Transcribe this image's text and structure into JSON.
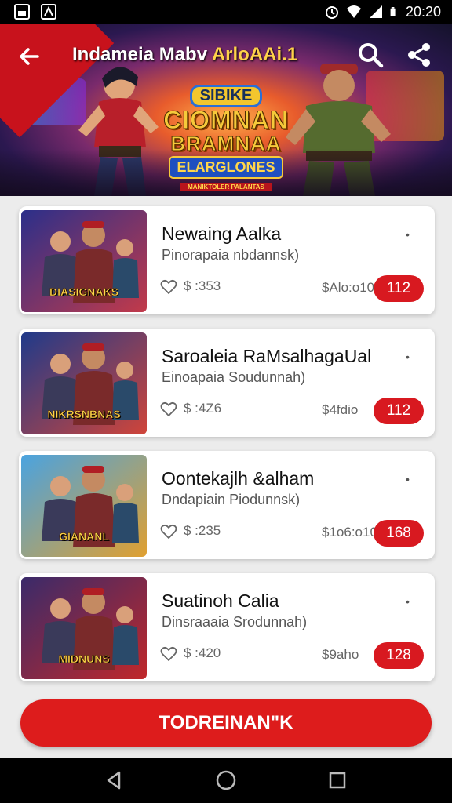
{
  "status_bar": {
    "time": "20:20",
    "icons": [
      "notification-icon",
      "app-icon",
      "alarm-icon",
      "wifi-icon",
      "signal-icon",
      "battery-icon"
    ]
  },
  "header": {
    "title_main": "Indameia Mabv ",
    "title_accent": "ArloAAi.1",
    "back_icon": "back-arrow-icon",
    "search_icon": "search-icon",
    "share_icon": "share-icon"
  },
  "banner": {
    "logo_top": "SIBIKE",
    "logo_line1": "CIOMNAN",
    "logo_line2": "BRAMNAA",
    "logo_bottom": "ELARGLONES",
    "logo_ribbon": "MANIKTOLER PALANTAS"
  },
  "items": [
    {
      "title": "Newaing Aalka",
      "subtitle": "Pinorapaia nbdannsk)",
      "price": "$ :353",
      "sales": "$Alo:o10",
      "badge": "112",
      "thumb_label": "DIASIGNAKS",
      "thumb_colors": [
        "#2b2f8a",
        "#c23a4a"
      ]
    },
    {
      "title": "Saroaleia RaMsalhagaUal",
      "subtitle": "Einoapaia Soudunnah)",
      "price": "$ :4Z6",
      "sales": "$4fdio",
      "badge": "112",
      "thumb_label": "NIKRSNBNAS",
      "thumb_colors": [
        "#1f3a8a",
        "#d0453a"
      ]
    },
    {
      "title": "Oontekajlh &alham",
      "subtitle": "Dndapiain Piodunnsk)",
      "price": "$ :235",
      "sales": "$1o6:o10",
      "badge": "168",
      "thumb_label": "GIANANL",
      "thumb_colors": [
        "#4aa3e0",
        "#e0a030"
      ]
    },
    {
      "title": "Suatinoh Calia",
      "subtitle": "Dinsraaaia Srodunnah)",
      "price": "$ :420",
      "sales": "$9aho",
      "badge": "128",
      "thumb_label": "MIDNUNS",
      "thumb_colors": [
        "#3a2a6a",
        "#c0282a"
      ]
    }
  ],
  "cta": {
    "label": "TODREINAN\"K"
  },
  "nav": {
    "icons": [
      "back-nav-icon",
      "home-nav-icon",
      "recents-nav-icon"
    ]
  },
  "colors": {
    "accent": "#dd1c1c",
    "badge": "#d81920",
    "background": "#ececec"
  }
}
